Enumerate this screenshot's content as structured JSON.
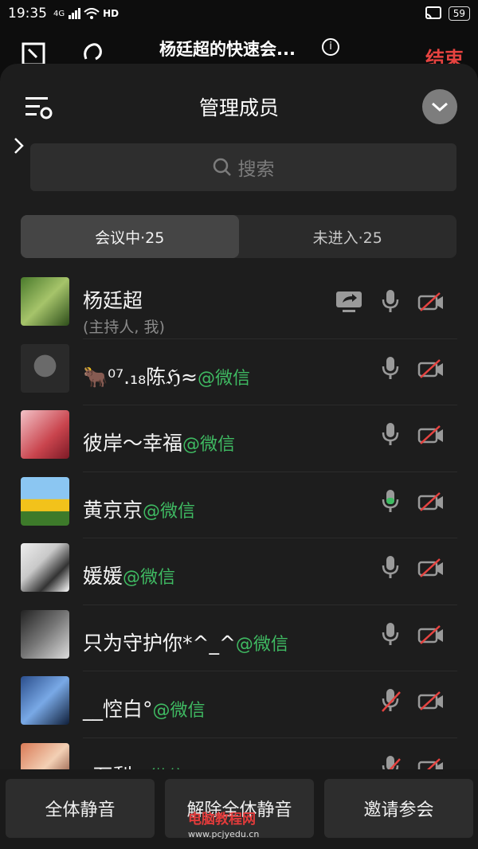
{
  "status_bar": {
    "time": "19:35",
    "network": "4G",
    "hd": "HD",
    "battery": "59"
  },
  "top_bar": {
    "meeting_title": "杨廷超的快速会...",
    "end_label": "结束"
  },
  "sheet": {
    "title": "管理成员",
    "search_placeholder": "搜索",
    "tabs": [
      {
        "label": "会议中·25"
      },
      {
        "label": "未进入·25"
      }
    ]
  },
  "members": [
    {
      "name": "杨廷超",
      "sub": "(主持人, 我)",
      "tag": "",
      "mic": "off",
      "cam": "off",
      "sharing": true
    },
    {
      "name": "🐂⁰⁷.₁₈陈ℌ≈",
      "sub": "",
      "tag": "@微信",
      "mic": "off",
      "cam": "off"
    },
    {
      "name": "彼岸～幸福",
      "sub": "",
      "tag": "@微信",
      "mic": "off",
      "cam": "off"
    },
    {
      "name": "黄京京",
      "sub": "",
      "tag": "@微信",
      "mic": "speaking",
      "cam": "off"
    },
    {
      "name": "媛媛",
      "sub": "",
      "tag": "@微信",
      "mic": "off",
      "cam": "off"
    },
    {
      "name": "只为守护你*^_^",
      "sub": "",
      "tag": "@微信",
      "mic": "off",
      "cam": "off"
    },
    {
      "name": "__悾白°",
      "sub": "",
      "tag": "@微信",
      "mic": "muted",
      "cam": "off"
    },
    {
      "name": "_石梨",
      "sub": "",
      "tag": "@微信",
      "mic": "muted",
      "cam": "off"
    }
  ],
  "bottom_bar": {
    "mute_all": "全体静音",
    "unmute_all": "解除全体静音",
    "invite": "邀请参会"
  },
  "watermark": {
    "text": "电脑教程网",
    "url": "www.pcjyedu.cn"
  },
  "colors": {
    "accent_green": "#3fba62",
    "end_red": "#e64340"
  }
}
